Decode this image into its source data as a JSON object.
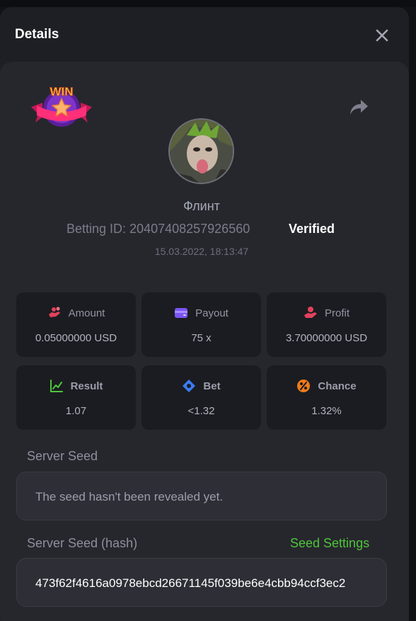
{
  "modal": {
    "title": "Details"
  },
  "player": {
    "name": "Флинт",
    "betting_id": "Betting ID: 20407408257926560",
    "verified_label": "Verified",
    "datetime": "15.03.2022, 18:13:47",
    "badge_text": "WIN"
  },
  "stats": [
    {
      "label": "Amount",
      "value": "0.05000000 USD",
      "icon": "coins-hand-icon",
      "color": "#e2425c"
    },
    {
      "label": "Payout",
      "value": "75 x",
      "icon": "wallet-icon",
      "color": "#7b55f4"
    },
    {
      "label": "Profit",
      "value": "3.70000000 USD",
      "icon": "profit-hand-icon",
      "color": "#e2425c"
    },
    {
      "label": "Result",
      "value": "1.07",
      "icon": "chart-check-icon",
      "color": "#4fc53a"
    },
    {
      "label": "Bet",
      "value": "<1.32",
      "icon": "ticket-icon",
      "color": "#3a7bf2"
    },
    {
      "label": "Chance",
      "value": "1.32%",
      "icon": "percent-icon",
      "color": "#f07a1a"
    }
  ],
  "server_seed": {
    "label": "Server Seed",
    "value": "The seed hasn't been revealed yet."
  },
  "server_seed_hash": {
    "label": "Server Seed (hash)",
    "settings_link": "Seed Settings",
    "value": "473f62f4616a0978ebcd26671145f039be6e4cbb94ccf3ec2"
  },
  "colors": {
    "accent_green": "#4fc53a",
    "modal_bg": "#1e1f24",
    "card_bg": "#26272d"
  }
}
